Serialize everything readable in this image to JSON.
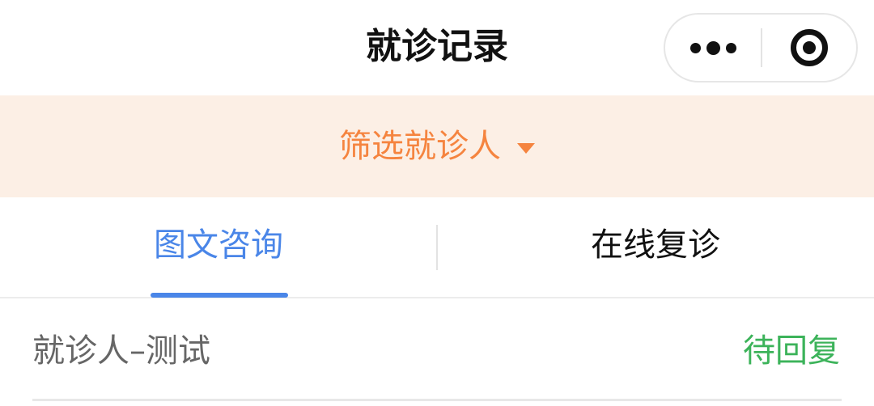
{
  "navbar": {
    "title": "就诊记录",
    "more_icon": "more-dots-icon",
    "close_icon": "target-close-icon"
  },
  "filter": {
    "label": "筛选就诊人",
    "caret_icon": "caret-down-icon",
    "color": "#f5843f",
    "background": "#fcefe5"
  },
  "tabs": [
    {
      "label": "图文咨询",
      "active": true
    },
    {
      "label": "在线复诊",
      "active": false
    }
  ],
  "accent": "#4a86e8",
  "records": [
    {
      "patient": "就诊人–测试",
      "status": "待回复",
      "status_color": "#3cb35a"
    }
  ]
}
